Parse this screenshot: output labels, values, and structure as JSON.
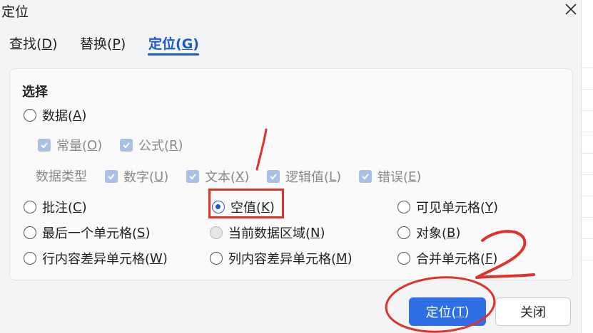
{
  "dialog": {
    "title": "定位",
    "close_icon": "close-icon"
  },
  "tabs": [
    {
      "label": "查找(",
      "key": "D",
      "suffix": ")"
    },
    {
      "label": "替换(",
      "key": "P",
      "suffix": ")"
    },
    {
      "label": "定位(",
      "key": "G",
      "suffix": ")",
      "active": true
    }
  ],
  "section": {
    "title": "选择"
  },
  "options": {
    "data": {
      "label": "数据(",
      "key": "A",
      "suffix": ")"
    },
    "constant": {
      "label": "常量(",
      "key": "O",
      "suffix": ")"
    },
    "formula": {
      "label": "公式(",
      "key": "R",
      "suffix": ")"
    },
    "data_type_label": "数据类型",
    "number": {
      "label": "数字(",
      "key": "U",
      "suffix": ")"
    },
    "text": {
      "label": "文本(",
      "key": "X",
      "suffix": ")"
    },
    "logical": {
      "label": "逻辑值(",
      "key": "L",
      "suffix": ")"
    },
    "error": {
      "label": "错误(",
      "key": "E",
      "suffix": ")"
    },
    "comment": {
      "label": "批注(",
      "key": "C",
      "suffix": ")"
    },
    "blank": {
      "label": "空值(",
      "key": "K",
      "suffix": ")",
      "selected": true
    },
    "visible_cells": {
      "label": "可见单元格(",
      "key": "Y",
      "suffix": ")"
    },
    "last_cell": {
      "label": "最后一个单元格(",
      "key": "S",
      "suffix": ")"
    },
    "current_region": {
      "label": "当前数据区域(",
      "key": "N",
      "suffix": ")"
    },
    "objects": {
      "label": "对象(",
      "key": "B",
      "suffix": ")"
    },
    "row_diff": {
      "label": "行内容差异单元格(",
      "key": "W",
      "suffix": ")"
    },
    "col_diff": {
      "label": "列内容差异单元格(",
      "key": "M",
      "suffix": ")"
    },
    "merged": {
      "label": "合并单元格(",
      "key": "F",
      "suffix": ")"
    }
  },
  "buttons": {
    "locate": {
      "label": "定位(",
      "key": "T",
      "suffix": ")"
    },
    "close": "关闭"
  },
  "colors": {
    "accent": "#1a57d6",
    "primary_button": "#2f6fe6",
    "annotation": "#e0312b"
  }
}
